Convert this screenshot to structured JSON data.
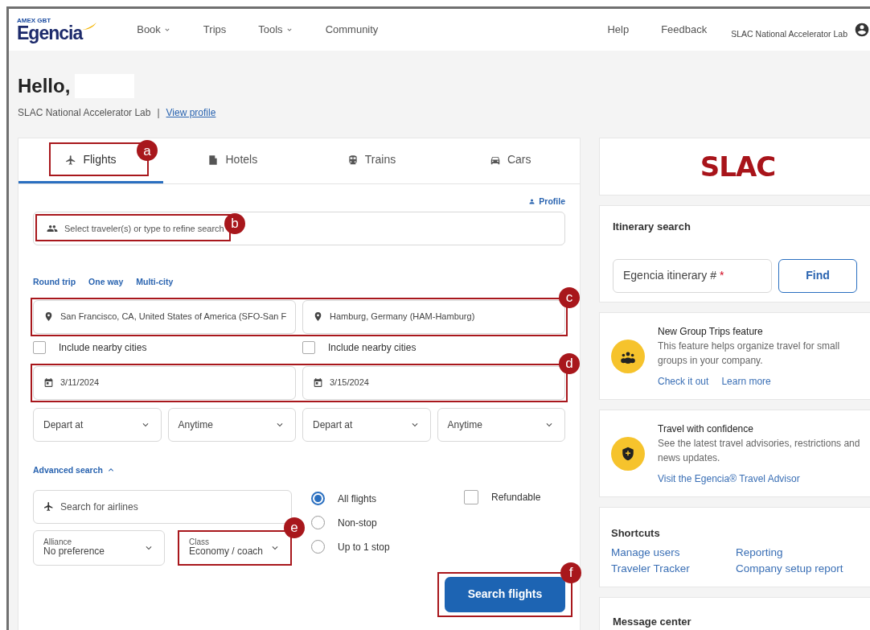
{
  "navbar": {
    "logo_tag": "AMEX GBT",
    "logo": "Egencia",
    "links": [
      {
        "label": "Book",
        "dropdown": true
      },
      {
        "label": "Trips",
        "dropdown": false
      },
      {
        "label": "Tools",
        "dropdown": true
      },
      {
        "label": "Community",
        "dropdown": false
      }
    ],
    "right_links": [
      "Help",
      "Feedback"
    ],
    "company": "SLAC National Accelerator Lab"
  },
  "greeting": {
    "title": "Hello,",
    "company": "SLAC National Accelerator Lab",
    "separator": "|",
    "profile_link": "View profile"
  },
  "tabs": [
    {
      "label": "Flights",
      "selected": true,
      "callout": "a"
    },
    {
      "label": "Hotels",
      "selected": false
    },
    {
      "label": "Trains",
      "selected": false
    },
    {
      "label": "Cars",
      "selected": false
    }
  ],
  "flight_form": {
    "profile_link": "Profile",
    "traveler_field": {
      "placeholder": "Select traveler(s) or type to refine search",
      "callout": "b"
    },
    "trip_types": [
      "Round trip",
      "One way",
      "Multi-city"
    ],
    "locations": {
      "callout": "c",
      "values": [
        "San Francisco, CA, United States of America (SFO-San F",
        "Hamburg, Germany (HAM-Hamburg)"
      ]
    },
    "nearby": [
      {
        "label": "Include nearby cities",
        "checked": false
      },
      {
        "label": "Include nearby cities",
        "checked": false
      }
    ],
    "dates": {
      "callout": "d",
      "values": [
        "3/11/2024",
        "3/15/2024"
      ]
    },
    "times": [
      "Depart at",
      "Anytime",
      "Depart at",
      "Anytime"
    ],
    "advanced_search": {
      "label": "Advanced search",
      "expanded": true
    },
    "airline_field": {
      "placeholder": "Search for airlines"
    },
    "alliance": {
      "label": "Alliance",
      "value": "No preference"
    },
    "class": {
      "label": "Class",
      "value": "Economy / coach",
      "callout": "e"
    },
    "stops": [
      {
        "label": "All flights",
        "selected": true
      },
      {
        "label": "Non-stop",
        "selected": false
      },
      {
        "label": "Up to 1 stop",
        "selected": false
      }
    ],
    "refundable": {
      "label": "Refundable",
      "checked": false
    },
    "search_button": {
      "label": "Search flights",
      "callout": "f"
    }
  },
  "sidebar": {
    "logo": "SLAC",
    "itinerary": {
      "title": "Itinerary search",
      "placeholder": "Egencia itinerary #",
      "required_mark": "*",
      "button": "Find"
    },
    "promos": [
      {
        "title": "New Group Trips feature",
        "text": "This feature helps organize travel for small groups in your company.",
        "links": [
          "Check it out",
          "Learn more"
        ]
      },
      {
        "title": "Travel with confidence",
        "text": "See the latest travel advisories, restrictions and news updates.",
        "links": [
          "Visit the Egencia® Travel Advisor"
        ]
      }
    ],
    "shortcuts": {
      "title": "Shortcuts",
      "links": [
        "Manage users",
        "Reporting",
        "Traveler Tracker",
        "Company setup report"
      ]
    },
    "message_center": {
      "title": "Message center"
    }
  }
}
